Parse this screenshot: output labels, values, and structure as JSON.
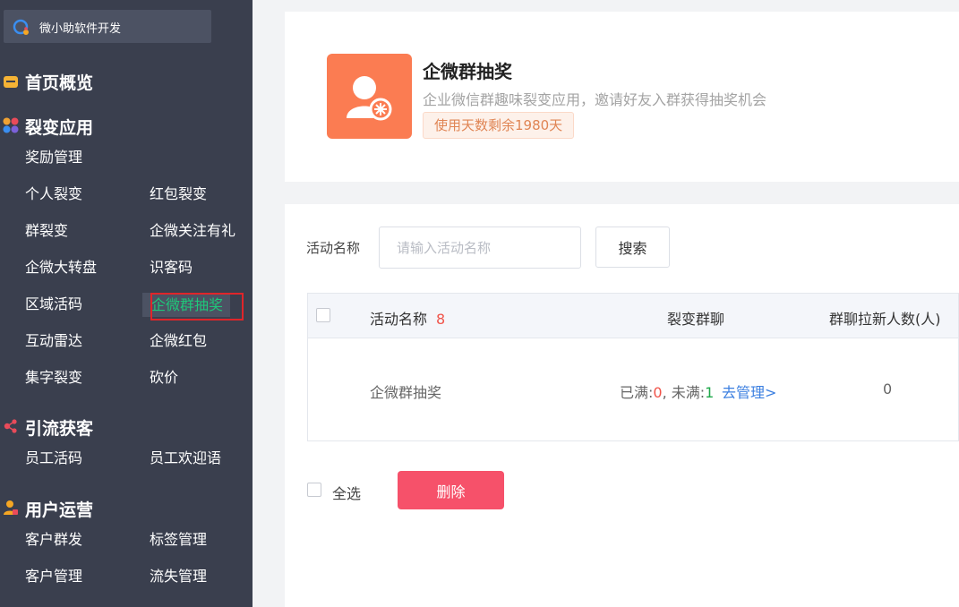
{
  "sidebar": {
    "brand": "微小助软件开发",
    "sections": {
      "home": "首页概览",
      "fission": "裂变应用",
      "traffic": "引流获客",
      "ops": "用户运营"
    },
    "items": {
      "reward_mgmt": "奖励管理",
      "personal_fission": "个人裂变",
      "redpacket_fission": "红包裂变",
      "group_fission": "群裂变",
      "wecom_follow_gift": "企微关注有礼",
      "wecom_wheel": "企微大转盘",
      "customer_code": "识客码",
      "region_code": "区域活码",
      "wecom_group_lottery": "企微群抽奖",
      "interactive_radar": "互动雷达",
      "wecom_redpacket": "企微红包",
      "collect_words": "集字裂变",
      "bargain": "砍价",
      "staff_code": "员工活码",
      "staff_welcome": "员工欢迎语",
      "customer_broadcast": "客户群发",
      "tag_mgmt": "标签管理",
      "customer_mgmt": "客户管理",
      "churn_mgmt": "流失管理"
    }
  },
  "app": {
    "title": "企微群抽奖",
    "description": "企业微信群趣味裂变应用，邀请好友入群获得抽奖机会",
    "days_badge": "使用天数剩余1980天"
  },
  "filter": {
    "label": "活动名称",
    "placeholder": "请输入活动名称",
    "search_label": "搜索"
  },
  "table": {
    "columns": {
      "name": "活动名称",
      "name_count": "8",
      "group": "裂变群聊",
      "new_users": "群聊拉新人数(人)"
    },
    "rows": [
      {
        "name": "企微群抽奖",
        "full_label": "已满:",
        "full_value": "0",
        "sep": ", ",
        "not_full_label": "未满:",
        "not_full_value": "1",
        "manage_link": "去管理>",
        "new_users": "0"
      }
    ]
  },
  "footer": {
    "select_all": "全选",
    "delete_label": "删除"
  },
  "colors": {
    "sidebar_bg": "#3a3f4e",
    "active_green": "#1fc77a",
    "app_icon_orange": "#fb7c52",
    "delete_pink": "#f6516a",
    "link_blue": "#3b7fe0"
  }
}
